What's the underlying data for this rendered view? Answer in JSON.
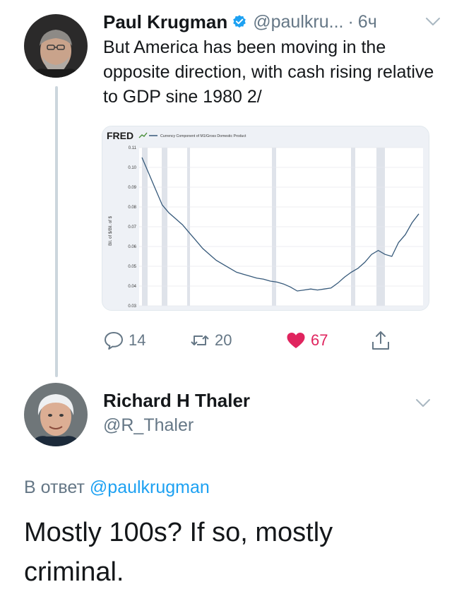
{
  "tweet1": {
    "author_name": "Paul Krugman",
    "handle": "@paulkru...",
    "separator": "·",
    "time": "6ч",
    "text": "But America has been moving in the opposite direction, with cash rising relative to GDP sine 1980 2/",
    "verified_icon": "verified-badge-icon",
    "actions": {
      "reply_count": "14",
      "retweet_count": "20",
      "like_count": "67"
    },
    "colors": {
      "like": "#e0245e",
      "verified": "#1da1f2",
      "muted": "#657786"
    }
  },
  "chart": {
    "logo": "FRED",
    "legend_label": "Currency Component of M1/Gross Domestic Product",
    "ylabel": "Bil. of $/Bil. of $"
  },
  "chart_data": {
    "type": "line",
    "title": "",
    "legend": "Currency Component of M1/Gross Domestic Product",
    "ylabel": "Bil. of $/Bil. of $",
    "xlabel": "",
    "ylim": [
      0.03,
      0.11
    ],
    "yticks": [
      "0.11",
      "0.10",
      "0.09",
      "0.08",
      "0.07",
      "0.06",
      "0.05",
      "0.04",
      "0.03"
    ],
    "grid": true,
    "recession_shading": true,
    "series": [
      {
        "values": [
          0.105,
          0.097,
          0.089,
          0.081,
          0.077,
          0.074,
          0.071,
          0.067,
          0.063,
          0.059,
          0.056,
          0.053,
          0.051,
          0.049,
          0.047,
          0.046,
          0.045,
          0.044,
          0.0435,
          0.0425,
          0.042,
          0.041,
          0.0395,
          0.0375,
          0.038,
          0.0385,
          0.038,
          0.0385,
          0.039,
          0.0415,
          0.0445,
          0.047,
          0.049,
          0.052,
          0.056,
          0.058,
          0.056,
          0.055,
          0.062,
          0.066,
          0.072,
          0.0765
        ]
      }
    ]
  },
  "tweet2": {
    "author_name": "Richard H Thaler",
    "handle": "@R_Thaler",
    "reply_prefix": "В ответ",
    "reply_mention": "@paulkrugman",
    "text": "Mostly 100s?  If so, mostly criminal."
  }
}
